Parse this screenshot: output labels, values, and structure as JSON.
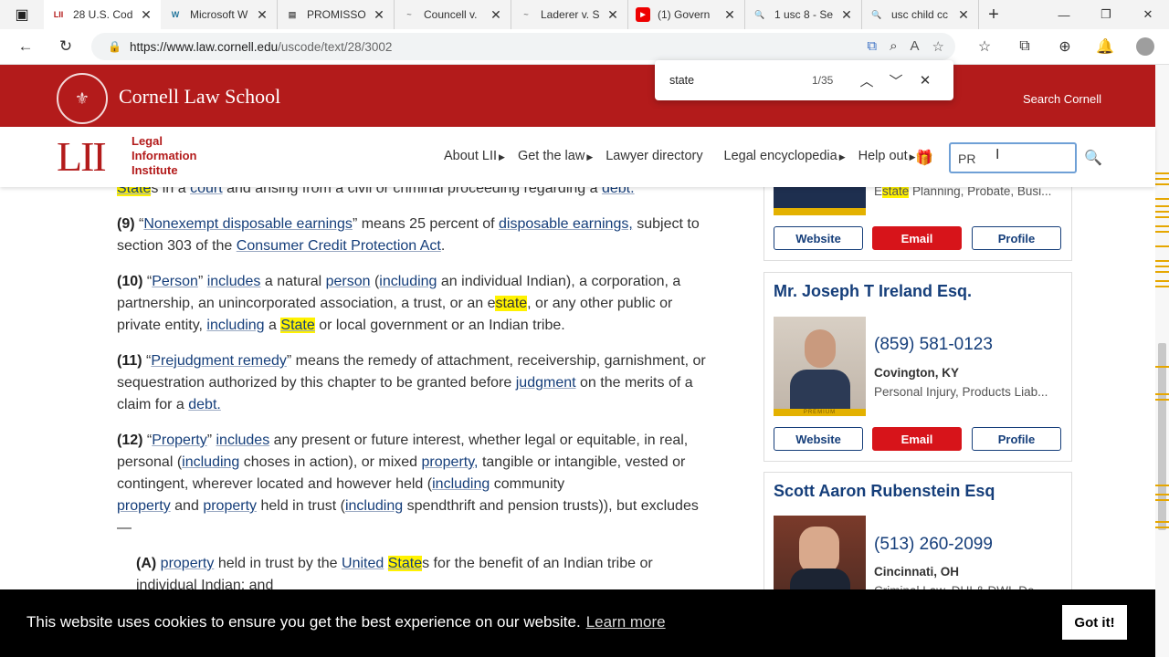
{
  "browser": {
    "tabs": [
      {
        "icon": "LII",
        "title": "28 U.S. Cod",
        "active": true
      },
      {
        "icon": "W",
        "title": "Microsoft W"
      },
      {
        "icon": "▤",
        "title": "PROMISSO"
      },
      {
        "icon": "~",
        "title": "Councell v."
      },
      {
        "icon": "~",
        "title": "Laderer v. S"
      },
      {
        "icon": "▶",
        "title": "(1) Govern"
      },
      {
        "icon": "🔍",
        "title": "1 usc 8 - Se"
      },
      {
        "icon": "🔍",
        "title": "usc child cc"
      }
    ],
    "url_host": "https://www.law.cornell.edu",
    "url_path": "/uscode/text/28/3002"
  },
  "findbar": {
    "query": "state",
    "count": "1/35"
  },
  "site": {
    "school": "Cornell Law School",
    "search_cornell": "Search Cornell",
    "lii_line1": "Legal",
    "lii_line2": "Information",
    "lii_line3": "Institute",
    "nav": [
      "About LII",
      "Get the law",
      "Lawyer directory",
      "Legal encyclopedia",
      "Help out"
    ],
    "search_value": "PR"
  },
  "content": {
    "top_line": {
      "a": "State",
      "b": "s in a",
      "c": "court",
      "d": "and arising from a civil or criminal proceeding regarding a",
      "e": "debt."
    },
    "p9": {
      "num": "(9)",
      "q1": "“",
      "term": "Nonexempt disposable earnings",
      "t1": "” means 25 percent of",
      "link1": "disposable earnings,",
      "t2": "subject to section 303 of the",
      "link2": "Consumer Credit Protection Act",
      "t3": "."
    },
    "p10": {
      "num": "(10)",
      "q1": "“",
      "term": "Person",
      "t1": "”",
      "link1": "includes",
      "t2": "a natural",
      "link2": "person",
      "t3": "(",
      "link3": "including",
      "t4": "an individual Indian), a corporation, a partnership, an unincorporated association, a trust, or an e",
      "hl1": "state",
      "t5": ", or any other public or private entity,",
      "link4": "including",
      "t6": "a",
      "hl2": "State",
      "t7": "or local government or an Indian tribe."
    },
    "p11": {
      "num": "(11)",
      "q1": "“",
      "term": "Prejudgment remedy",
      "t1": "” means the remedy of attachment, receivership, garnishment, or sequestration authorized by this chapter to be granted before",
      "link1": "judgment",
      "t2": "on the merits of a claim for a",
      "link2": "debt."
    },
    "p12": {
      "num": "(12)",
      "q1": "“",
      "term": "Property",
      "t1": "”",
      "link1": "includes",
      "t2": "any present or future interest, whether legal or equitable, in real, personal (",
      "link2": "including",
      "t3": "choses in action), or mixed",
      "link3": "property,",
      "t4": "tangible or intangible, vested or contingent, wherever located and however held (",
      "link4": "including",
      "t5": "community",
      "link5": "property",
      "t6": "and",
      "link6": "property",
      "t7": "held in trust (",
      "link7": "including",
      "t8": "spendthrift and pension trusts)), but excludes—"
    },
    "pA": {
      "num": "(A)",
      "link1": "property",
      "t1": "held in trust by the",
      "link2": "United",
      "hl1": "State",
      "t2": "s for the benefit of an Indian tribe or individual Indian; and"
    }
  },
  "sidebar": {
    "card0": {
      "spec_pre": "E",
      "spec_hl": "state",
      "spec_post": " Planning, Probate, Busi...",
      "website": "Website",
      "email": "Email",
      "profile": "Profile"
    },
    "card1": {
      "name": "Mr. Joseph T Ireland Esq.",
      "phone": "(859) 581-0123",
      "city": "Covington, KY",
      "spec": "Personal Injury, Products Liab...",
      "website": "Website",
      "email": "Email",
      "profile": "Profile",
      "badge": "PREMIUM"
    },
    "card2": {
      "name": "Scott Aaron Rubenstein Esq",
      "phone": "(513) 260-2099",
      "city": "Cincinnati, OH",
      "spec": "Criminal Law, DUI & DWI, De..."
    }
  },
  "cookie": {
    "message": "This website uses cookies to ensure you get the best experience on our website.",
    "learn_more": "Learn more",
    "button": "Got it!"
  },
  "colors": {
    "brand_red": "#b31b1b",
    "link_blue": "#153e7a",
    "highlight": "#fff200",
    "email_red": "#d7141a"
  }
}
